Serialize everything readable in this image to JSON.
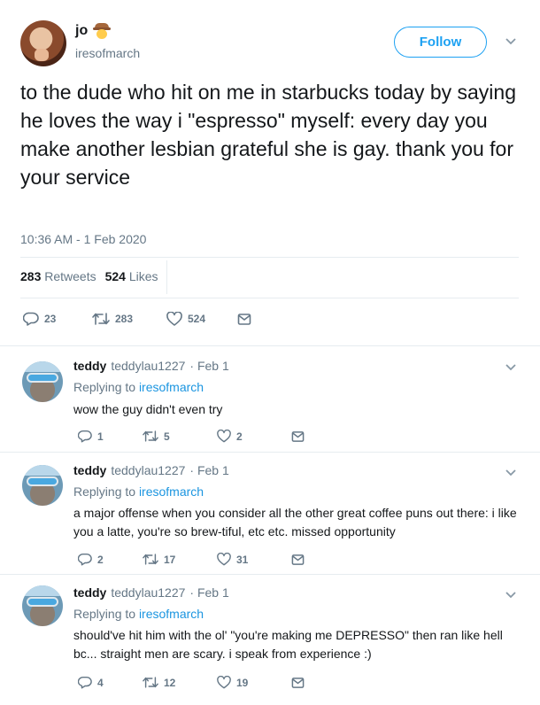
{
  "main_tweet": {
    "display_name": "jo",
    "handle": "iresofmarch",
    "follow_label": "Follow",
    "text": "to the dude who hit on me in starbucks today by saying he loves the way i \"espresso\" myself: every day you make another lesbian grateful she is gay. thank you for your service",
    "timestamp": "10:36 AM - 1 Feb 2020",
    "retweets_count": "283",
    "retweets_label": "Retweets",
    "likes_count": "524",
    "likes_label": "Likes",
    "actions": {
      "replies": "23",
      "retweets": "283",
      "likes": "524"
    }
  },
  "replies": [
    {
      "name": "teddy",
      "handle": "teddylau1227",
      "date": "· Feb 1",
      "replying_prefix": "Replying to",
      "replying_to": "iresofmarch",
      "text": "wow the guy didn't even try",
      "actions": {
        "replies": "1",
        "retweets": "5",
        "likes": "2"
      }
    },
    {
      "name": "teddy",
      "handle": "teddylau1227",
      "date": "· Feb 1",
      "replying_prefix": "Replying to",
      "replying_to": "iresofmarch",
      "text": "a major offense when you consider all the other great coffee puns out there: i like you a latte, you're so brew-tiful, etc etc. missed opportunity",
      "actions": {
        "replies": "2",
        "retweets": "17",
        "likes": "31"
      }
    },
    {
      "name": "teddy",
      "handle": "teddylau1227",
      "date": "· Feb 1",
      "replying_prefix": "Replying to",
      "replying_to": "iresofmarch",
      "text": "should've hit him with the ol' \"you're making me DEPRESSO\" then ran like hell bc... straight men are scary. i speak from experience :)",
      "actions": {
        "replies": "4",
        "retweets": "12",
        "likes": "19"
      }
    }
  ],
  "colors": {
    "accent": "#1da1f2",
    "link": "#1b95e0",
    "muted": "#657786",
    "text": "#14171a",
    "divider": "#e6ecf0"
  },
  "icons": [
    "reply-icon",
    "retweet-icon",
    "like-icon",
    "direct-message-icon",
    "chevron-down-icon",
    "cowboy-emoji-icon"
  ]
}
